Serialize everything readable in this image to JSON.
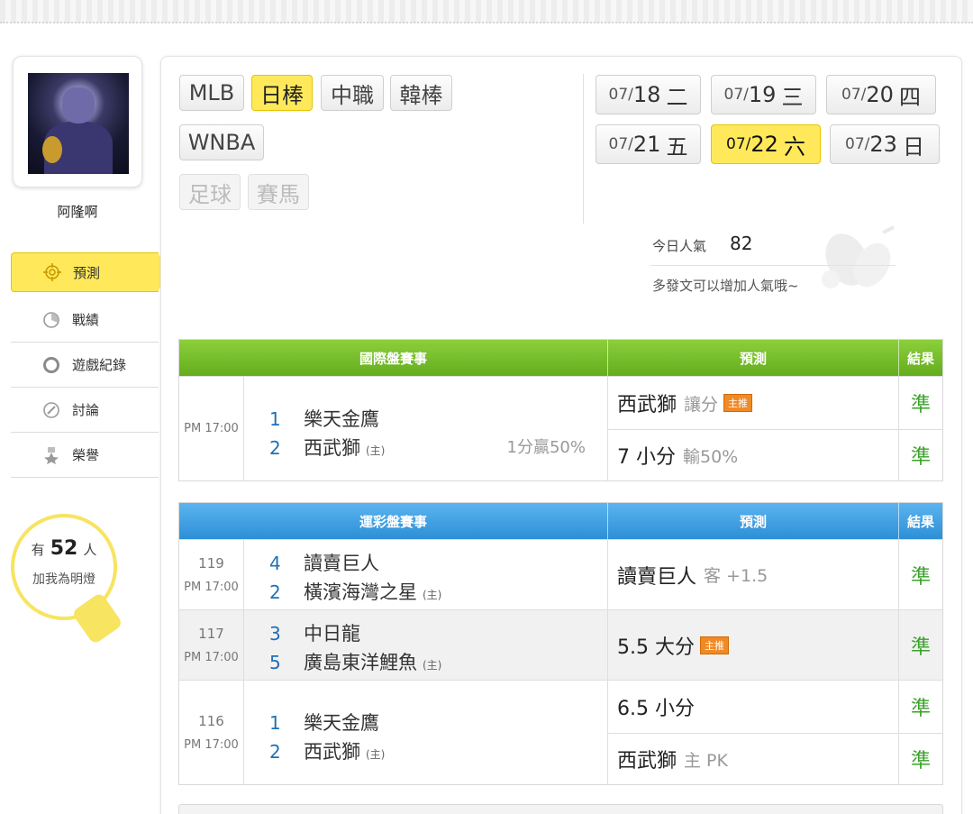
{
  "sidebar": {
    "username": "阿隆啊",
    "nav": [
      {
        "label": "預測",
        "icon": "target-icon"
      },
      {
        "label": "戰績",
        "icon": "chart-icon"
      },
      {
        "label": "遊戲紀錄",
        "icon": "ring-icon"
      },
      {
        "label": "討論",
        "icon": "pencil-icon"
      },
      {
        "label": "榮譽",
        "icon": "medal-icon"
      }
    ],
    "fans": {
      "prefix": "有",
      "count": "52",
      "suffix": "人",
      "line2": "加我為明燈"
    }
  },
  "leagues": {
    "mlb": "MLB",
    "npb": "日棒",
    "cpbl": "中職",
    "kbo": "韓棒",
    "wnba": "WNBA",
    "soccer": "足球",
    "horse": "賽馬",
    "active": "日棒"
  },
  "dates": [
    {
      "mo": "07/",
      "dy": "18",
      "wd": "二"
    },
    {
      "mo": "07/",
      "dy": "19",
      "wd": "三"
    },
    {
      "mo": "07/",
      "dy": "20",
      "wd": "四"
    },
    {
      "mo": "07/",
      "dy": "21",
      "wd": "五"
    },
    {
      "mo": "07/",
      "dy": "22",
      "wd": "六"
    },
    {
      "mo": "07/",
      "dy": "23",
      "wd": "日"
    }
  ],
  "popularity": {
    "label": "今日人氣",
    "value": "82",
    "note": "多發文可以增加人氣哦~"
  },
  "intl": {
    "head": {
      "match": "國際盤賽事",
      "pred": "預測",
      "res": "結果"
    },
    "rows": [
      {
        "time": "PM 17:00",
        "t1": {
          "n": "1",
          "name": "樂天金鷹"
        },
        "t2": {
          "n": "2",
          "name": "西武獅",
          "home": "(主)"
        },
        "odds": "1分贏50%",
        "preds": [
          {
            "main": "西武獅",
            "sub": "讓分",
            "tag": "主推",
            "res": "準"
          },
          {
            "main": "7 小分",
            "sub": "輸50%",
            "res": "準"
          }
        ]
      }
    ]
  },
  "lottery": {
    "head": {
      "match": "運彩盤賽事",
      "pred": "預測",
      "res": "結果"
    },
    "rows": [
      {
        "code": "119",
        "time": "PM 17:00",
        "t1": {
          "n": "4",
          "name": "讀賣巨人"
        },
        "t2": {
          "n": "2",
          "name": "橫濱海灣之星",
          "home": "(主)"
        },
        "preds": [
          {
            "main": "讀賣巨人",
            "sub": "客 +1.5",
            "res": "準"
          }
        ]
      },
      {
        "code": "117",
        "time": "PM 17:00",
        "t1": {
          "n": "3",
          "name": "中日龍"
        },
        "t2": {
          "n": "5",
          "name": "廣島東洋鯉魚",
          "home": "(主)"
        },
        "preds": [
          {
            "main": "5.5 大分",
            "tag": "主推",
            "res": "準"
          }
        ]
      },
      {
        "code": "116",
        "time": "PM 17:00",
        "t1": {
          "n": "1",
          "name": "樂天金鷹"
        },
        "t2": {
          "n": "2",
          "name": "西武獅",
          "home": "(主)"
        },
        "preds": [
          {
            "main": "6.5 小分",
            "res": "準"
          },
          {
            "main": "西武獅",
            "sub": "主 PK",
            "res": "準"
          }
        ]
      }
    ]
  },
  "colors": {
    "accent_yellow": "#ffe95a",
    "green_header": "#6fb52a",
    "blue_header": "#3a9ae0",
    "result_green": "#3aa12a",
    "team_number_blue": "#1f6fb5"
  }
}
